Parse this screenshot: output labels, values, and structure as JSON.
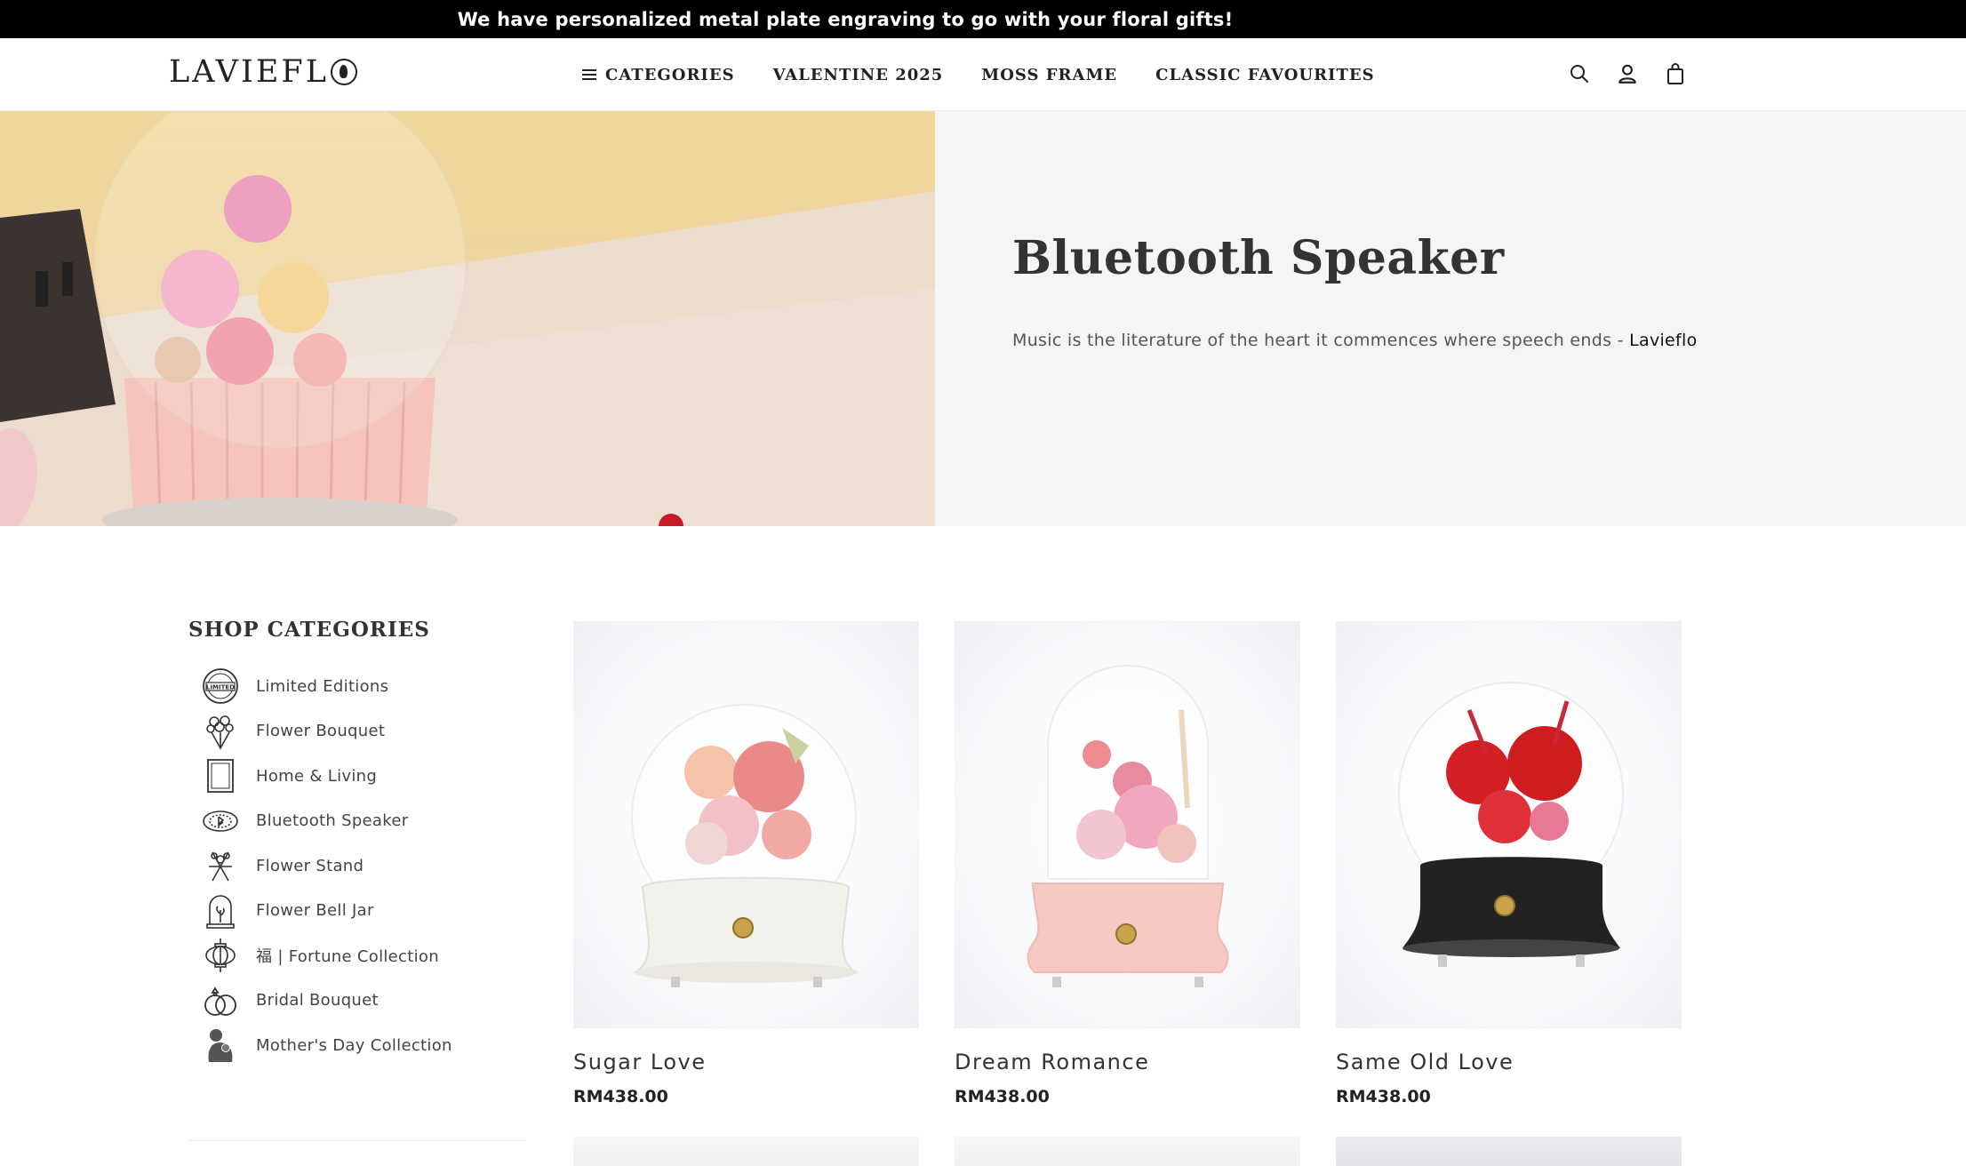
{
  "announcement": {
    "text": "We have personalized metal plate engraving to go with your floral gifts!"
  },
  "header": {
    "logo": "LAVIEFL",
    "nav": [
      {
        "label": "CATEGORIES",
        "has_menu_icon": true
      },
      {
        "label": "VALENTINE 2025"
      },
      {
        "label": "MOSS FRAME"
      },
      {
        "label": "CLASSIC FAVOURITES"
      }
    ],
    "icons": [
      "search-icon",
      "account-icon",
      "cart-icon"
    ]
  },
  "hero": {
    "title": "Bluetooth Speaker",
    "description": "Music is the literature of the heart it commences where speech ends - ",
    "brand": "Lavieflo"
  },
  "sidebar": {
    "title": "SHOP CATEGORIES",
    "categories": [
      {
        "label": "Limited Editions",
        "icon": "limited-badge-icon"
      },
      {
        "label": "Flower Bouquet",
        "icon": "bouquet-icon"
      },
      {
        "label": "Home & Living",
        "icon": "frame-icon"
      },
      {
        "label": "Bluetooth Speaker",
        "icon": "speaker-icon"
      },
      {
        "label": "Flower Stand",
        "icon": "flower-stand-icon"
      },
      {
        "label": "Flower Bell Jar",
        "icon": "bell-jar-icon"
      },
      {
        "label": "福 | Fortune Collection",
        "icon": "lantern-icon"
      },
      {
        "label": "Bridal Bouquet",
        "icon": "rings-icon"
      },
      {
        "label": "Mother's Day Collection",
        "icon": "mother-child-icon"
      }
    ]
  },
  "products": [
    {
      "name": "Sugar Love",
      "price": "RM438.00",
      "base_color": "#f3f1ec",
      "flower_color": "#e98a88",
      "dome": "sphere"
    },
    {
      "name": "Dream Romance",
      "price": "RM438.00",
      "base_color": "#f6c9c5",
      "flower_color": "#f1a7be",
      "dome": "bell"
    },
    {
      "name": "Same Old Love",
      "price": "RM438.00",
      "base_color": "#222222",
      "flower_color": "#cf1c1f",
      "dome": "sphere"
    }
  ],
  "colors": {
    "announce_bg": "#000000",
    "hero_panel_bg": "#f5f5f5",
    "text_dark": "#222222"
  }
}
